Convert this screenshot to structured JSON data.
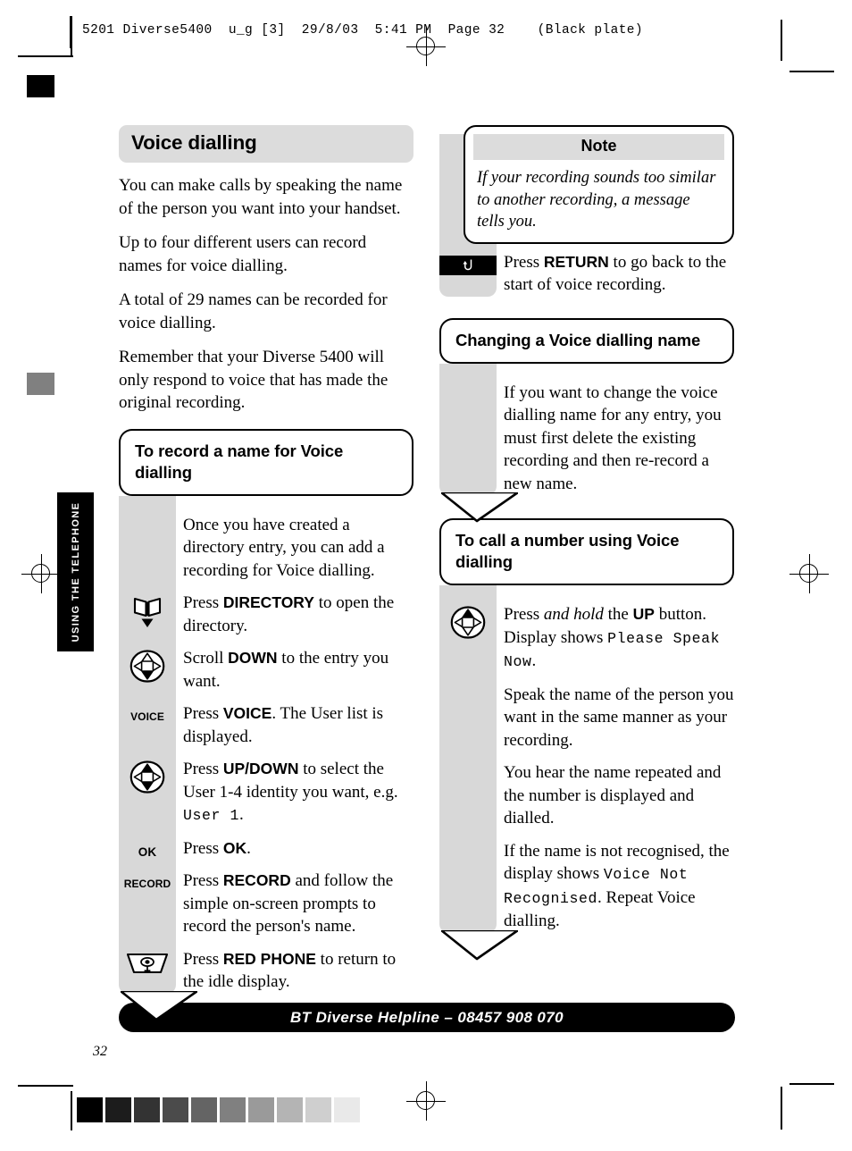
{
  "prepress": {
    "slug": "5201 Diverse5400  u_g [3]  29/8/03  5:41 PM  Page 32    (Black plate)",
    "grey_steps": [
      "#000000",
      "#1c1c1c",
      "#333333",
      "#4b4b4b",
      "#646464",
      "#808080",
      "#9a9a9a",
      "#b4b4b4",
      "#cfcfcf",
      "#e9e9e9"
    ],
    "tab_mark_black": "#000000",
    "tab_mark_grey": "#808080"
  },
  "side_tab": {
    "label": "USING THE TELEPHONE"
  },
  "left_column": {
    "heading": "Voice dialling",
    "intro_paragraphs": [
      "You can make calls by speaking the name of the person you want into your handset.",
      "Up to four different users can record names for voice dialling.",
      "A total of 29 names can be recorded for voice dialling.",
      "Remember that your Diverse 5400 will only respond to voice that has made the original recording."
    ],
    "section": {
      "title": "To record a name for Voice dialling",
      "steps": [
        {
          "icon": "none",
          "icon_label": "",
          "text": "Once you have created a directory entry, you can add a recording for Voice dialling."
        },
        {
          "icon": "directory-icon",
          "icon_label": "",
          "text": "Press <b>DIRECTORY</b> to open the directory."
        },
        {
          "icon": "navpad-down-icon",
          "icon_label": "",
          "text": "Scroll <b>DOWN</b> to the entry you want."
        },
        {
          "icon": "text-key",
          "icon_label": "VOICE",
          "text": "Press <b>VOICE</b>. The User list is displayed."
        },
        {
          "icon": "navpad-updown-icon",
          "icon_label": "",
          "text": "Press <b>UP/DOWN</b> to select the User 1-4 identity you want, e.g. <span class=\"lcd\">User 1</span>."
        },
        {
          "icon": "text-key",
          "icon_label": "OK",
          "text": "Press <b>OK</b>."
        },
        {
          "icon": "text-key",
          "icon_label": "RECORD",
          "text": "Press <b>RECORD</b> and follow the simple on-screen prompts to record the person's name."
        },
        {
          "icon": "red-phone-icon",
          "icon_label": "",
          "text": "Press <b>RED PHONE</b> to return to the idle display."
        }
      ]
    }
  },
  "right_column": {
    "note": {
      "header": "Note",
      "body": "If your recording sounds too similar to another recording, a message tells you."
    },
    "return_step": {
      "icon": "return-arrow-icon",
      "text": "Press <b>RETURN</b> to go back to the start of voice recording."
    },
    "section_change": {
      "title": "Changing a Voice dialling name",
      "steps": [
        {
          "icon": "none",
          "icon_label": "",
          "text": "If you want to change the voice dialling name for any entry, you must first delete the existing recording and then re-record a new name."
        }
      ]
    },
    "section_call": {
      "title": "To call a number using Voice dialling",
      "steps": [
        {
          "icon": "navpad-up-icon",
          "icon_label": "",
          "text": "Press <i>and hold</i> the <b>UP</b> button. Display shows <span class=\"lcd\">Please Speak Now</span>."
        },
        {
          "icon": "none",
          "icon_label": "",
          "text": "Speak the name of the person you want in the same manner as your recording."
        },
        {
          "icon": "none",
          "icon_label": "",
          "text": "You hear the name repeated and the number is displayed and dialled."
        },
        {
          "icon": "none",
          "icon_label": "",
          "text": "If the name is not recognised, the display shows <span class=\"lcd\">Voice Not Recognised</span>. Repeat Voice dialling."
        }
      ]
    }
  },
  "footer": {
    "helpline": "BT Diverse Helpline – 08457 908 070",
    "page_number": "32"
  }
}
